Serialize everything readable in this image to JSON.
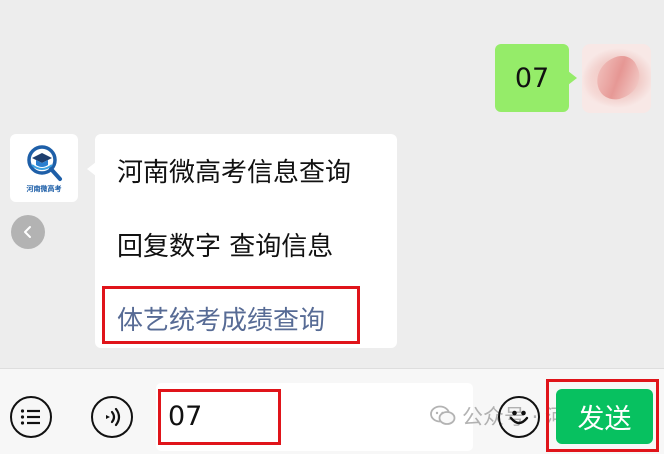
{
  "chat": {
    "outgoing": {
      "text": "07"
    },
    "incoming": {
      "avatar_caption": "河南微高考",
      "line1": "河南微高考信息查询",
      "line2": "回复数字 查询信息",
      "link": "体艺统考成绩查询"
    }
  },
  "input_bar": {
    "value": "07",
    "watermark": "公众号 · 河南微",
    "send_label": "发送"
  },
  "colors": {
    "outgoing_bubble": "#95ec69",
    "link": "#576b95",
    "send_button": "#07c160",
    "highlight": "#e0141a"
  },
  "icons": [
    "menu-icon",
    "voice-icon",
    "emoji-icon",
    "back-icon",
    "wechat-icon"
  ]
}
